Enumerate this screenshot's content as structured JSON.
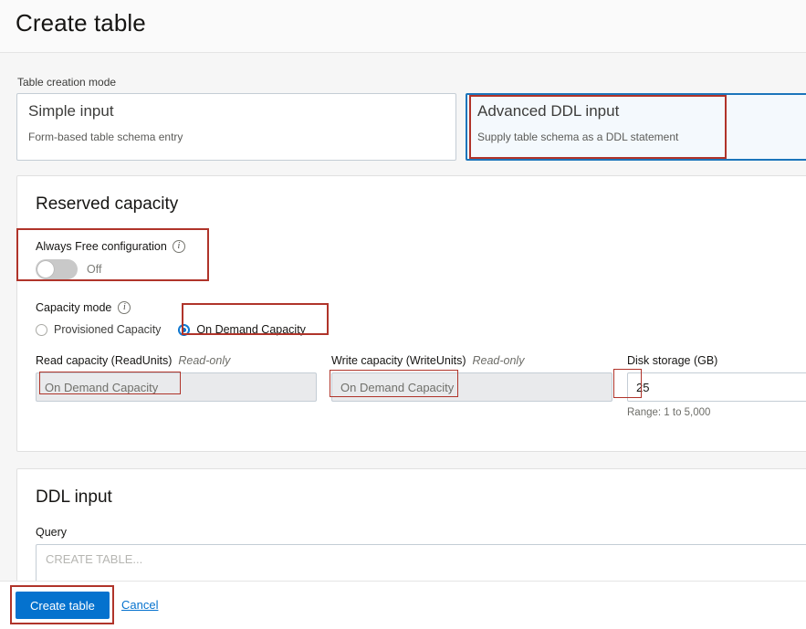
{
  "header": {
    "title": "Create table"
  },
  "mode_section": {
    "label": "Table creation mode",
    "cards": [
      {
        "title": "Simple input",
        "subtitle": "Form-based table schema entry",
        "selected": false
      },
      {
        "title": "Advanced DDL input",
        "subtitle": "Supply table schema as a DDL statement",
        "selected": true
      }
    ]
  },
  "reserved_capacity": {
    "title": "Reserved capacity",
    "always_free": {
      "label": "Always Free configuration",
      "info_icon": "info-icon",
      "state_text": "Off",
      "checked": false
    },
    "capacity_mode": {
      "label": "Capacity mode",
      "info_icon": "info-icon",
      "options": [
        {
          "label": "Provisioned Capacity",
          "selected": false
        },
        {
          "label": "On Demand Capacity",
          "selected": true
        }
      ]
    },
    "fields": {
      "read_capacity": {
        "label": "Read capacity (ReadUnits)",
        "readonly_tag": "Read-only",
        "value": "On Demand Capacity"
      },
      "write_capacity": {
        "label": "Write capacity (WriteUnits)",
        "readonly_tag": "Read-only",
        "value": "On Demand Capacity"
      },
      "disk_storage": {
        "label": "Disk storage (GB)",
        "value": "25",
        "help": "Range: 1 to 5,000"
      }
    }
  },
  "ddl_input": {
    "title": "DDL input",
    "query_label": "Query",
    "query_placeholder": "CREATE TABLE..."
  },
  "footer": {
    "submit_label": "Create table",
    "cancel_label": "Cancel"
  },
  "colors": {
    "accent_blue": "#0572ce",
    "selected_card_border": "#1b75bb",
    "selected_card_bg": "#f4f9fd",
    "annotation_red": "#b0342a",
    "page_bg": "#f6f6f6"
  }
}
